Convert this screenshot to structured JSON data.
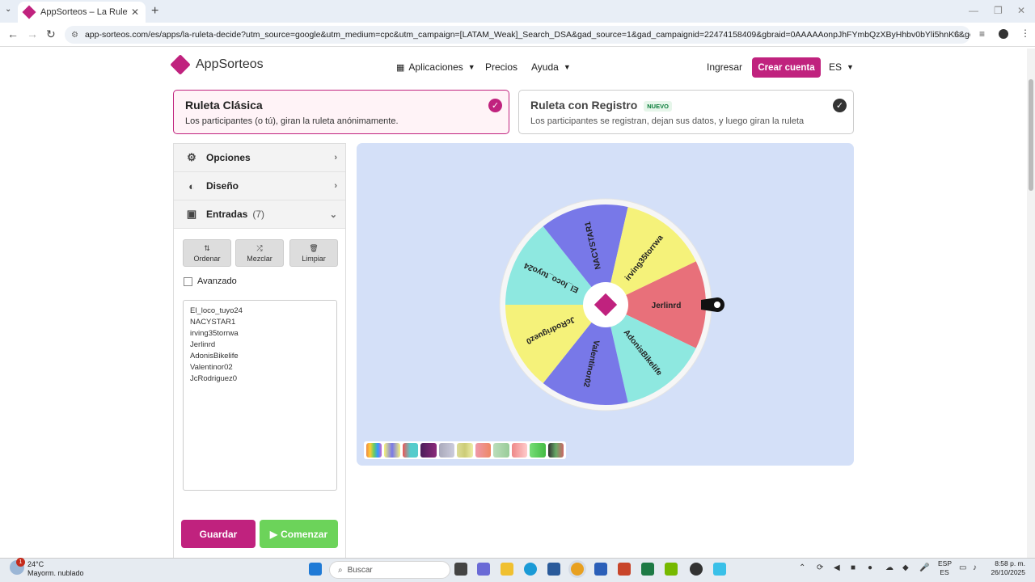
{
  "browser": {
    "tab_title": "AppSorteos – La Ruleta de la Su",
    "url": "app-sorteos.com/es/apps/la-ruleta-decide?utm_source=google&utm_medium=cpc&utm_campaign=[LATAM_Weak]_Search_DSA&gad_source=1&gad_campaignid=22474158409&gbraid=0AAAAAonpJhFYmbQzXByHhbv0bYli5hnK6&gclid=CjwKCAjwjffHBhB..."
  },
  "header": {
    "logo_text": "AppSorteos",
    "nav_apps": "Aplicaciones",
    "nav_prices": "Precios",
    "nav_help": "Ayuda",
    "login": "Ingresar",
    "signup": "Crear cuenta",
    "lang": "ES"
  },
  "modes": [
    {
      "title": "Ruleta Clásica",
      "subtitle": "Los participantes (o tú), giran la ruleta anónimamente.",
      "selected": true
    },
    {
      "title": "Ruleta con Registro",
      "badge": "NUEVO",
      "subtitle": "Los participantes se registran, dejan sus datos, y luego giran la ruleta",
      "selected": false
    }
  ],
  "sidebar": {
    "options": "Opciones",
    "design": "Diseño",
    "entries_label": "Entradas",
    "entries_count": "(7)",
    "tools": {
      "sort": "Ordenar",
      "shuffle": "Mezclar",
      "clear": "Limpiar"
    },
    "advanced": "Avanzado",
    "save": "Guardar",
    "start": "Comenzar"
  },
  "entries": [
    "El_loco_tuyo24",
    "NACYSTAR1",
    "irving35torrwa",
    "Jerlinrd",
    "AdonisBikelife",
    "Valentinor02",
    "JcRodriguez0"
  ],
  "wheel": {
    "segments": [
      {
        "name": "Jerlinrd",
        "color": "#e8707a"
      },
      {
        "name": "AdonisBikelife",
        "color": "#8ee8e0"
      },
      {
        "name": "Valentinor02",
        "color": "#7878e8"
      },
      {
        "name": "JcRodriguez0",
        "color": "#f5f27a"
      },
      {
        "name": "El_loco_tuyo24",
        "color": "#8ee8e0"
      },
      {
        "name": "NACYSTAR1",
        "color": "#7878e8"
      },
      {
        "name": "irving35torrwa",
        "color": "#f5f27a"
      }
    ]
  },
  "taskbar": {
    "temperature": "24°C",
    "weather": "Mayorm. nublado",
    "notification_count": "1",
    "search": "Buscar",
    "lang_top": "ESP",
    "lang_bottom": "ES",
    "time": "8:58 p. m.",
    "date": "26/10/2025"
  },
  "colors": {
    "brand": "#c0227e",
    "start": "#6cd35a",
    "stage": "#d4e0f8"
  }
}
